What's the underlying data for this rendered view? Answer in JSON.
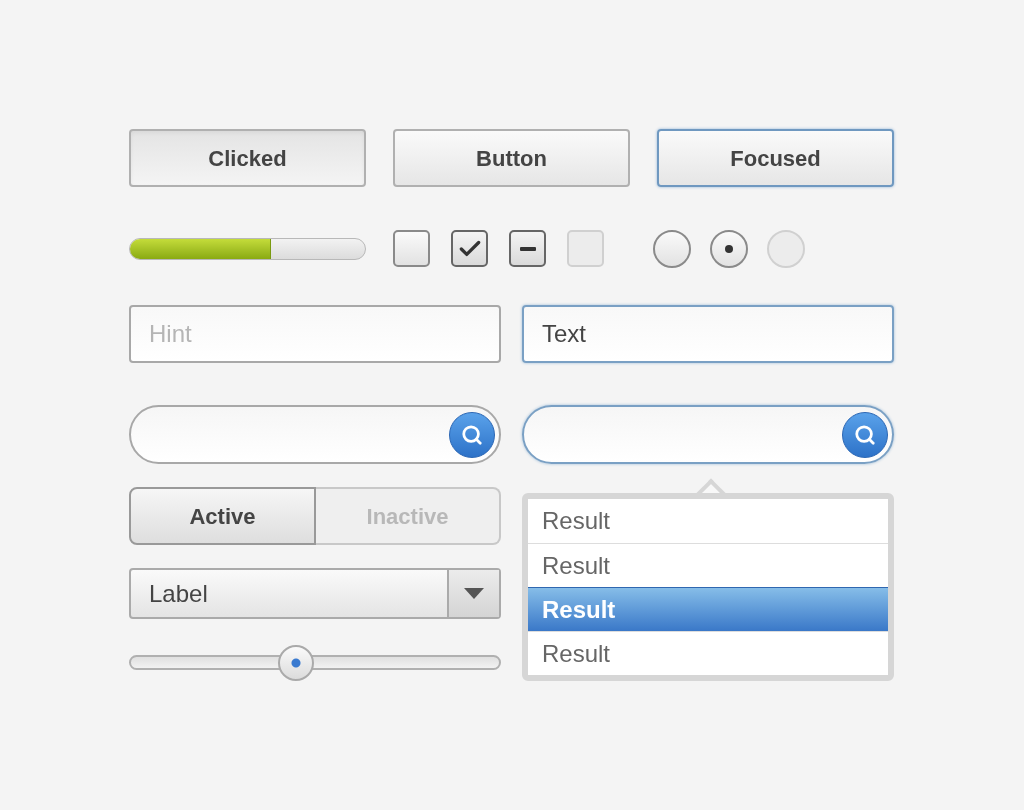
{
  "buttons": [
    {
      "label": "Clicked",
      "pressed": true,
      "focused": false
    },
    {
      "label": "Button",
      "pressed": false,
      "focused": false
    },
    {
      "label": "Focused",
      "pressed": false,
      "focused": true
    }
  ],
  "progress": {
    "level": 0.6
  },
  "checkboxes": [
    {
      "checked": false,
      "mixed": false,
      "disabled": false
    },
    {
      "checked": true,
      "mixed": false,
      "disabled": false
    },
    {
      "checked": true,
      "mixed": true,
      "disabled": false
    },
    {
      "checked": false,
      "mixed": false,
      "disabled": true
    }
  ],
  "radios": [
    {
      "selected": false,
      "disabled": false
    },
    {
      "selected": true,
      "disabled": false
    },
    {
      "selected": false,
      "disabled": true
    }
  ],
  "text_fields": [
    {
      "placeholder": "Hint",
      "focused": false
    },
    {
      "value": "Text",
      "focused": true
    }
  ],
  "search_fields": [
    {
      "focused": false
    },
    {
      "focused": true
    }
  ],
  "segmented": [
    {
      "label": "Active",
      "selected": true
    },
    {
      "label": "Inactive",
      "selected": false
    }
  ],
  "select": {
    "value": "Label"
  },
  "slider": {
    "level": 0.45
  },
  "results": [
    {
      "label": "Result",
      "selected": false
    },
    {
      "label": "Result",
      "selected": false
    },
    {
      "label": "Result",
      "selected": true
    },
    {
      "label": "Result",
      "selected": false
    }
  ]
}
